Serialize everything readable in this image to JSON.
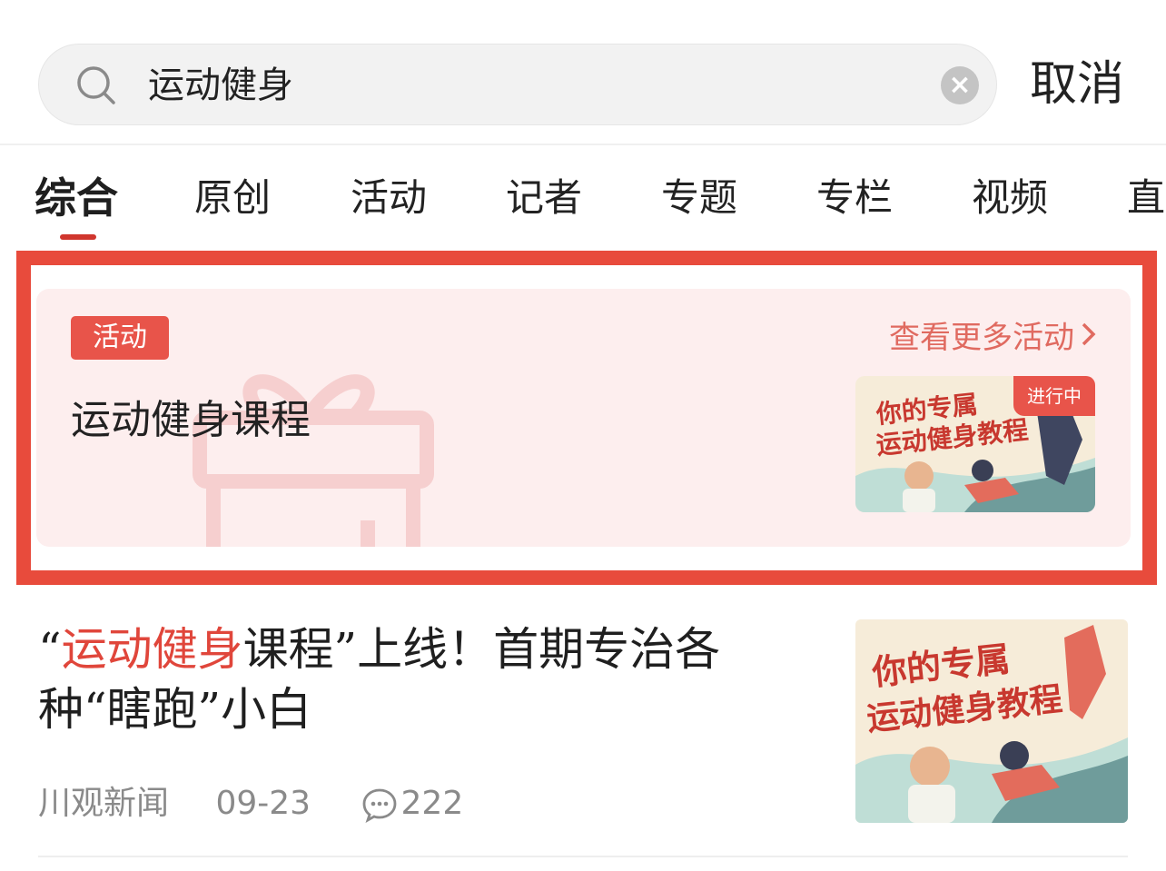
{
  "search": {
    "query": "运动健身",
    "cancel_label": "取消"
  },
  "tabs": [
    {
      "label": "综合",
      "active": true
    },
    {
      "label": "原创"
    },
    {
      "label": "活动"
    },
    {
      "label": "记者"
    },
    {
      "label": "专题"
    },
    {
      "label": "专栏"
    },
    {
      "label": "视频"
    },
    {
      "label": "直播"
    }
  ],
  "activity": {
    "tag": "活动",
    "title": "运动健身课程",
    "more_label": "查看更多活动",
    "status": "进行中",
    "thumb_text_line1": "你的专属",
    "thumb_text_line2": "运动健身教程"
  },
  "news": {
    "title_open_quote": "“",
    "title_highlight": "运动健身",
    "title_rest": "课程”上线！首期专治各种“瞎跑”小白",
    "source": "川观新闻",
    "date": "09-23",
    "comments": "222",
    "thumb_text_line1": "你的专属",
    "thumb_text_line2": "运动健身教程"
  },
  "colors": {
    "accent": "#e84b3c",
    "card_bg": "#fdeeee",
    "link": "#e06a60"
  },
  "icons": [
    "search-icon",
    "clear-icon",
    "gift-icon",
    "chevron-right-icon",
    "comment-icon"
  ]
}
